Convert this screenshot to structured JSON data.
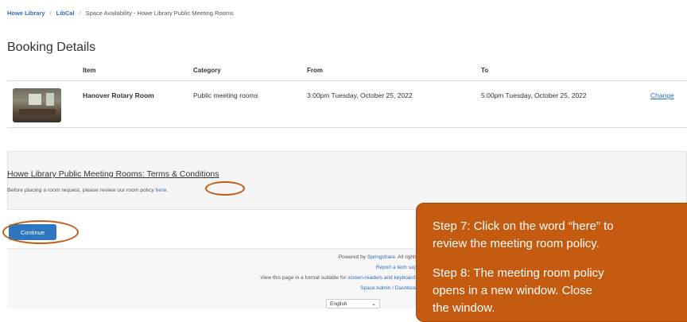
{
  "breadcrumb": {
    "items": [
      "Howe Library",
      "LibCal",
      "Space Availability - Howe Library Public Meeting Rooms"
    ]
  },
  "page_title": "Booking Details",
  "booking_table": {
    "headers": [
      "Item",
      "Category",
      "From",
      "To"
    ],
    "row": {
      "item": "Hanover Rotary Room",
      "category": "Public meeting rooms",
      "from": "3:00pm Tuesday, October 25, 2022",
      "to": "5:00pm Tuesday, October 25, 2022",
      "action": "Change"
    }
  },
  "terms": {
    "title": "Howe Library Public Meeting Rooms: Terms & Conditions",
    "body_prefix": "Before placing a room request, please review our room policy ",
    "link": "here."
  },
  "continue_label": "Continue",
  "footer": {
    "powered_by_prefix": "Powered by ",
    "powered_by_link": "Springshare",
    "powered_by_suffix": ". All rights reserved.",
    "support_link": "Report a tech support issue.",
    "accessible_prefix": "View this page in a format suitable for ",
    "accessible_link": "screen-readers and keyboard-only users",
    "admin_links": "Space Admin / Dashboard / Logout",
    "language": "English"
  },
  "callout": {
    "step7": "Step 7:  Click on the word “here” to",
    "step7b": "review the meeting room policy.",
    "step8": "Step 8:  The meeting room policy",
    "step8b": "opens in a new window.  Close",
    "step8c": "the window."
  },
  "colors": {
    "accent": "#2e77c0",
    "link": "#2a6ebb",
    "annotation": "#c55a11"
  }
}
